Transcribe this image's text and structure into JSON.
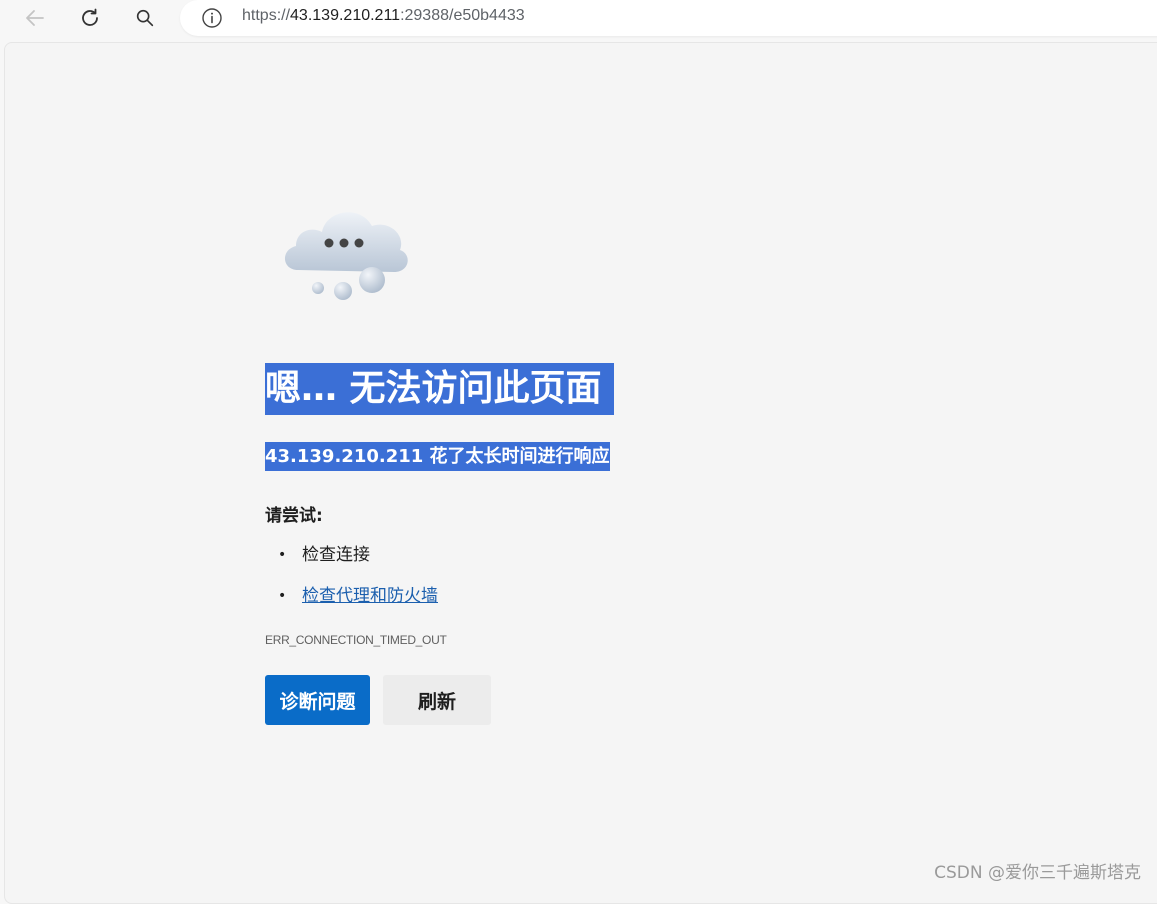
{
  "browser": {
    "url_scheme": "https://",
    "url_host": "43.139.210.211",
    "url_rest": ":29388/e50b4433",
    "icons": [
      "back-arrow-icon",
      "refresh-icon",
      "search-icon",
      "info-icon"
    ]
  },
  "error_page": {
    "title": "嗯… 无法访问此页面",
    "subtitle": "43.139.210.211 花了太长时间进行响应",
    "try_label": "请尝试:",
    "suggestions": [
      {
        "bullet": "•",
        "text": "检查连接",
        "link": false
      },
      {
        "bullet": "•",
        "text": "检查代理和防火墙",
        "link": true
      }
    ],
    "error_code": "ERR_CONNECTION_TIMED_OUT",
    "primary_button": "诊断问题",
    "secondary_button": "刷新"
  },
  "watermark": "CSDN @爱你三千遍斯塔克",
  "colors": {
    "selection_highlight": "#3b6fd6",
    "primary_button": "#0a6cc8",
    "link": "#1b5fae"
  }
}
